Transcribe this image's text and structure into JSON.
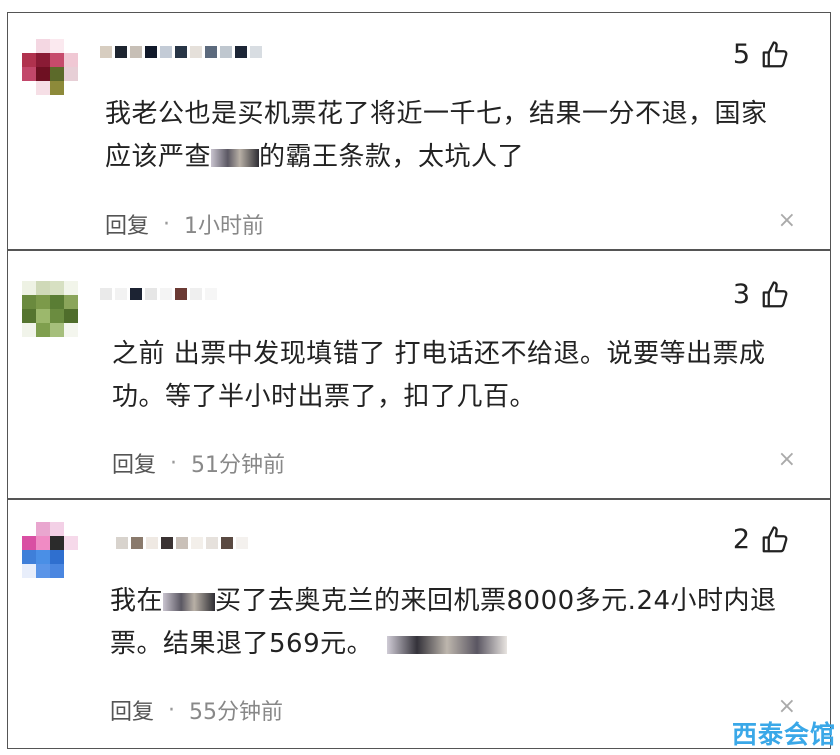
{
  "comments": [
    {
      "likes": "5",
      "text_line1": "我老公也是买机票花了将近一千七，结果一分不退，国家",
      "text_line2_pre": "应该严查",
      "text_line2_post": "的霸王条款，太坑人了",
      "reply_label": "回复",
      "dot": "·",
      "time": "1小时前",
      "close": "×"
    },
    {
      "likes": "3",
      "text_line1": "之前 出票中发现填错了 打电话还不给退。说要等出票成",
      "text_line2": "功。等了半小时出票了，扣了几百。",
      "reply_label": "回复",
      "dot": "·",
      "time": "51分钟前",
      "close": "×"
    },
    {
      "likes": "2",
      "text_line1_pre": "我在",
      "text_line1_post": "买了去奥克兰的来回机票8000多元.24小时内退",
      "text_line2": "票。结果退了569元。",
      "reply_label": "回复",
      "dot": "·",
      "time": "55分钟前",
      "close": "×"
    }
  ],
  "watermark": "西泰会馆",
  "icons": {
    "like": "thumbs-up-icon",
    "close": "close-icon"
  }
}
